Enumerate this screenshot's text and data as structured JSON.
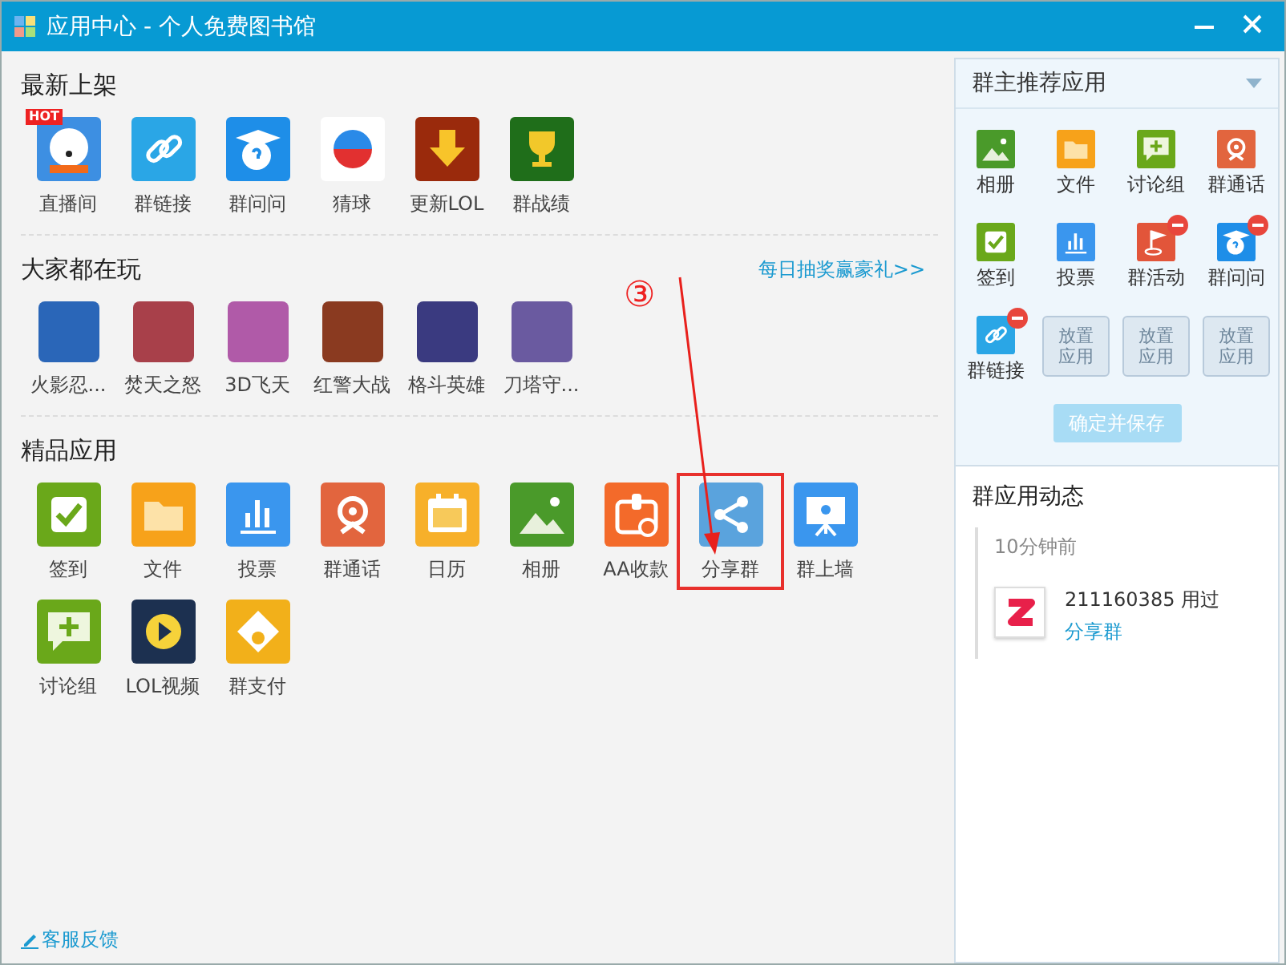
{
  "window": {
    "title": "应用中心 - 个人免费图书馆"
  },
  "sections": [
    {
      "title": "最新上架",
      "apps": [
        {
          "label": "直播间",
          "kind": "app",
          "color": "#3d8fe2",
          "badge": "HOT"
        },
        {
          "label": "群链接",
          "kind": "app",
          "color": "#2aa6e6"
        },
        {
          "label": "群问问",
          "kind": "app",
          "color": "#1e8ee8"
        },
        {
          "label": "猜球",
          "kind": "app",
          "color": "#ffffff"
        },
        {
          "label": "更新LOL",
          "kind": "app",
          "color": "#9a2a0c"
        },
        {
          "label": "群战绩",
          "kind": "app",
          "color": "#1f6e1a"
        }
      ]
    },
    {
      "title": "大家都在玩",
      "link": "每日抽奖赢豪礼>>",
      "apps": [
        {
          "label": "火影忍...",
          "kind": "game",
          "color": "#2a66b8"
        },
        {
          "label": "焚天之怒",
          "kind": "game",
          "color": "#a8404a"
        },
        {
          "label": "3D飞天",
          "kind": "game",
          "color": "#b05aa8"
        },
        {
          "label": "红警大战",
          "kind": "game",
          "color": "#8a3a20"
        },
        {
          "label": "格斗英雄",
          "kind": "game",
          "color": "#3a3a80"
        },
        {
          "label": "刀塔守...",
          "kind": "game",
          "color": "#6a5aa0"
        }
      ]
    },
    {
      "title": "精品应用",
      "apps": [
        {
          "label": "签到",
          "kind": "app",
          "color": "#6aa81a",
          "highlighted": false
        },
        {
          "label": "文件",
          "kind": "app",
          "color": "#f7a21a",
          "highlighted": false
        },
        {
          "label": "投票",
          "kind": "app",
          "color": "#3a96ee",
          "highlighted": false
        },
        {
          "label": "群通话",
          "kind": "app",
          "color": "#e2653e",
          "highlighted": false
        },
        {
          "label": "日历",
          "kind": "app",
          "color": "#f7b02a",
          "highlighted": false
        },
        {
          "label": "相册",
          "kind": "app",
          "color": "#4a9a2a",
          "highlighted": false
        },
        {
          "label": "AA收款",
          "kind": "app",
          "color": "#f36a2a",
          "highlighted": false
        },
        {
          "label": "分享群",
          "kind": "app",
          "color": "#5aa3dd",
          "highlighted": true
        },
        {
          "label": "群上墙",
          "kind": "app",
          "color": "#3a96ee",
          "highlighted": false
        },
        {
          "label": "讨论组",
          "kind": "app",
          "color": "#6aa81a",
          "highlighted": false
        },
        {
          "label": "LOL视频",
          "kind": "app",
          "color": "#1c3050",
          "highlighted": false
        },
        {
          "label": "群支付",
          "kind": "app",
          "color": "#f2b01a",
          "highlighted": false
        }
      ]
    }
  ],
  "feedback": "客服反馈",
  "annotation": {
    "label": "③"
  },
  "recommended": {
    "title": "群主推荐应用",
    "apps": [
      {
        "label": "相册",
        "kind": "app",
        "color": "#4a9a2a",
        "removable": false
      },
      {
        "label": "文件",
        "kind": "app",
        "color": "#f7a21a",
        "removable": false
      },
      {
        "label": "讨论组",
        "kind": "app",
        "color": "#6aa81a",
        "removable": false
      },
      {
        "label": "群通话",
        "kind": "app",
        "color": "#e2653e",
        "removable": false
      },
      {
        "label": "签到",
        "kind": "app",
        "color": "#6aa81a",
        "removable": false
      },
      {
        "label": "投票",
        "kind": "app",
        "color": "#3a96ee",
        "removable": false
      },
      {
        "label": "群活动",
        "kind": "app",
        "color": "#e2553a",
        "removable": true
      },
      {
        "label": "群问问",
        "kind": "app",
        "color": "#1e8ee8",
        "removable": true
      },
      {
        "label": "群链接",
        "kind": "app",
        "color": "#2aa6e6",
        "removable": true
      },
      {
        "label": "放置应用",
        "kind": "slot"
      },
      {
        "label": "放置应用",
        "kind": "slot"
      },
      {
        "label": "放置应用",
        "kind": "slot"
      }
    ],
    "save_button": {
      "label": "确定并保存",
      "disabled": true
    }
  },
  "activity": {
    "title": "群应用动态",
    "entries": [
      {
        "time": "10分钟前",
        "user": "211160385",
        "action": "用过",
        "app": "分享群"
      }
    ]
  }
}
